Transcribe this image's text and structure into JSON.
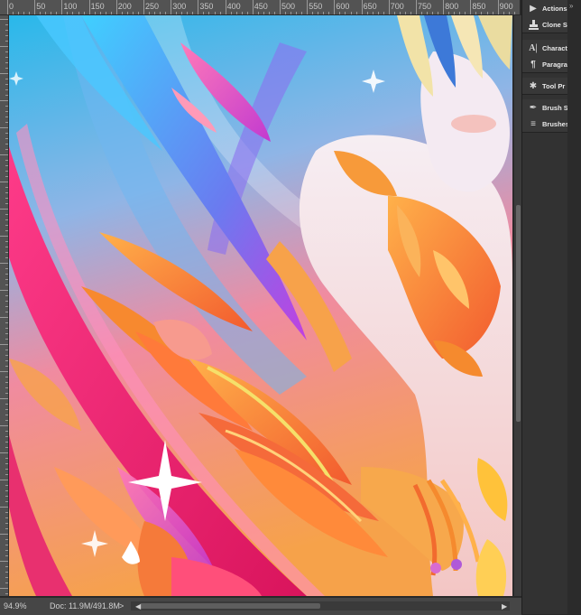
{
  "ruler": {
    "labels": [
      "0",
      "50",
      "100",
      "150",
      "200",
      "250",
      "300",
      "350",
      "400",
      "450",
      "500",
      "550",
      "600",
      "650",
      "700",
      "750",
      "800",
      "850",
      "900"
    ]
  },
  "status": {
    "zoom": "94.9%",
    "doc": "Doc: 11.9M/491.8M",
    "arrow": ">"
  },
  "panels": {
    "groups": [
      {
        "items": [
          {
            "label": "Actions",
            "icon": "play-icon"
          },
          {
            "label": "Clone S",
            "icon": "clone-stamp-icon"
          }
        ]
      },
      {
        "items": [
          {
            "label": "Charact",
            "icon": "character-icon"
          },
          {
            "label": "Paragra",
            "icon": "paragraph-icon"
          }
        ]
      },
      {
        "items": [
          {
            "label": "Tool Pr",
            "icon": "tool-presets-icon"
          }
        ]
      },
      {
        "items": [
          {
            "label": "Brush S",
            "icon": "brush-settings-icon"
          },
          {
            "label": "Brushes",
            "icon": "brushes-icon"
          }
        ]
      }
    ]
  },
  "colors": {
    "panel_bg": "#323232",
    "ruler_bg": "#535353",
    "sky_top": "#2fb6e8",
    "sky_bottom": "#f4a24a",
    "magenta": "#e6247a",
    "orange": "#f7892f"
  }
}
